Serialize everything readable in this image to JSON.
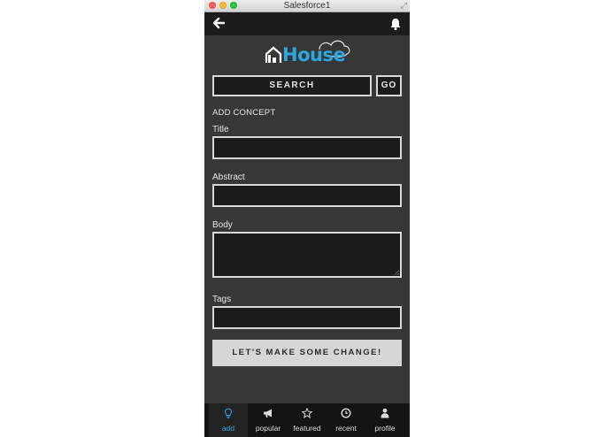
{
  "window": {
    "title": "Salesforce1"
  },
  "logo": {
    "text": "House"
  },
  "search": {
    "label": "SEARCH",
    "go_label": "GO"
  },
  "form": {
    "section_title": "ADD CONCEPT",
    "fields": [
      {
        "label": "Title",
        "value": ""
      },
      {
        "label": "Abstract",
        "value": ""
      },
      {
        "label": "Body",
        "value": ""
      },
      {
        "label": "Tags",
        "value": ""
      }
    ],
    "submit_label": "LET'S MAKE SOME CHANGE!"
  },
  "tabs": [
    {
      "label": "add",
      "icon": "lightbulb-icon",
      "active": true
    },
    {
      "label": "popular",
      "icon": "megaphone-icon",
      "active": false
    },
    {
      "label": "featured",
      "icon": "star-icon",
      "active": false
    },
    {
      "label": "recent",
      "icon": "clock-icon",
      "active": false
    },
    {
      "label": "profile",
      "icon": "person-icon",
      "active": false
    }
  ],
  "colors": {
    "accent": "#2aa8df",
    "background": "#373737",
    "bar": "#1c1c1c",
    "button": "#d6d6d6"
  }
}
